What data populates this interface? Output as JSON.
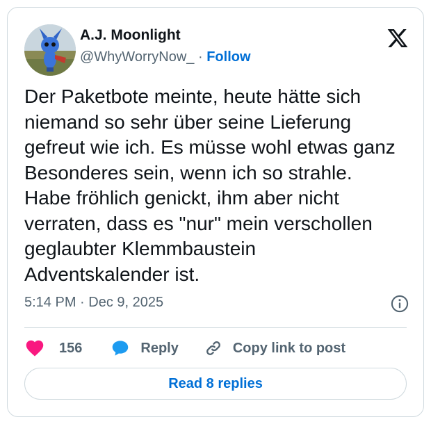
{
  "author": {
    "display_name": "A.J. Moonlight",
    "handle": "@WhyWorryNow_",
    "separator": "·",
    "follow_label": "Follow",
    "avatar_icon": "avatar-photo"
  },
  "brand_icon": "x-logo-icon",
  "tweet": {
    "text": "Der Paketbote meinte, heute hätte sich niemand so sehr über seine Lieferung gefreut wie ich. Es müsse wohl etwas ganz Besonderes sein, wenn ich so strahle. Habe fröhlich genickt, ihm aber nicht verraten, dass es \"nur\" mein verschollen geglaubter Klemmbaustein Adventskalender ist.",
    "time": "5:14 PM",
    "separator": "·",
    "date": "Dec 9, 2025"
  },
  "actions": {
    "like_count": "156",
    "reply_label": "Reply",
    "copy_link_label": "Copy link to post"
  },
  "read_replies_label": "Read 8 replies",
  "colors": {
    "accent": "#006fd6",
    "like": "#f91880",
    "reply_bubble": "#1d9bf0",
    "muted_text": "#536471",
    "border": "#cfd9de"
  }
}
